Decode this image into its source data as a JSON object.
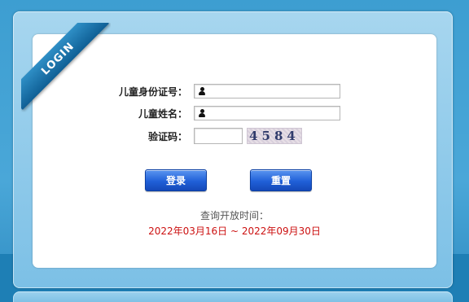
{
  "ribbon": {
    "text": "LOGIN"
  },
  "form": {
    "id_label": "儿童身份证号：",
    "id_value": "",
    "name_label": "儿童姓名：",
    "name_value": "",
    "captcha_label": "验证码：",
    "captcha_value": "",
    "captcha_image_text": "4584"
  },
  "buttons": {
    "login": "登录",
    "reset": "重置"
  },
  "query": {
    "label": "查询开放时间：",
    "range": "2022年03月16日 ~ 2022年09月30日"
  },
  "colors": {
    "accent": "#2060d8",
    "range_text": "#cc1111",
    "background": "#3d9ed1"
  },
  "icons": {
    "id_field_icon": "user-icon",
    "name_field_icon": "user-icon"
  }
}
